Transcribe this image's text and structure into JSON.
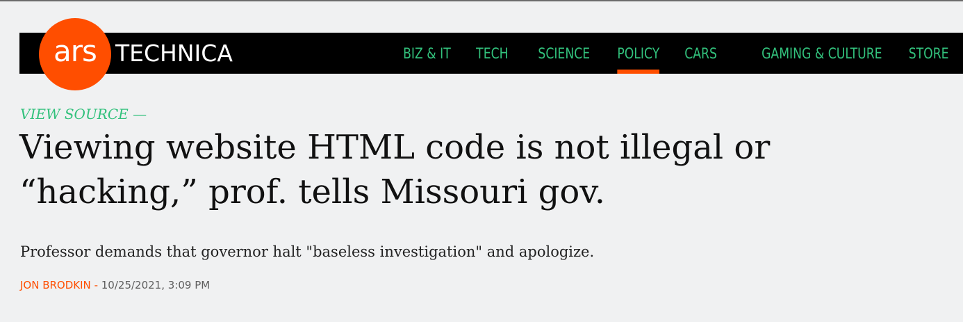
{
  "site": {
    "logo_short": "ars",
    "logo_long": "TECHNICA"
  },
  "nav": {
    "items": [
      {
        "label": "BIZ & IT"
      },
      {
        "label": "TECH"
      },
      {
        "label": "SCIENCE"
      },
      {
        "label": "POLICY"
      },
      {
        "label": "CARS"
      },
      {
        "label": "GAMING & CULTURE"
      },
      {
        "label": "STORE"
      }
    ],
    "active": "POLICY"
  },
  "article": {
    "kicker": "VIEW SOURCE —",
    "headline": "Viewing website HTML code is not illegal or “hacking,” prof. tells Missouri gov.",
    "dek": "Professor demands that governor halt \"baseless investigation\" and apologize.",
    "author": "JON BRODKIN",
    "byline_separator": "-",
    "timestamp": "10/25/2021, 3:09 PM"
  },
  "colors": {
    "accent": "#ff4e00",
    "nav_text": "#32c17c",
    "navbar_bg": "#000000",
    "page_bg": "#f0f1f2"
  }
}
